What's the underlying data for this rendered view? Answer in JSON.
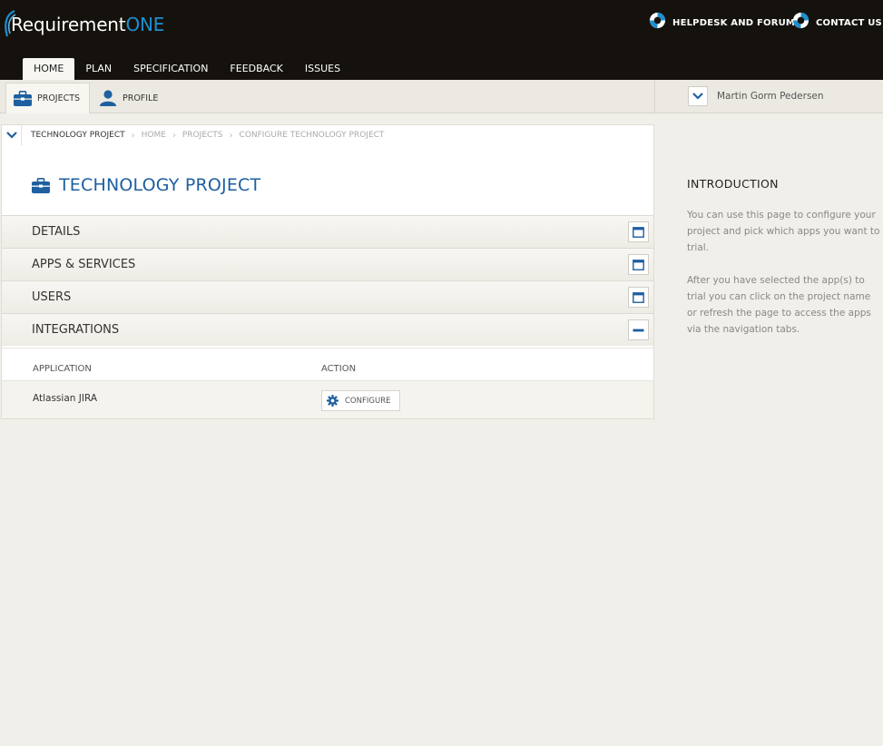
{
  "header": {
    "logo_main": "Requirement",
    "logo_accent": "ONE",
    "links": [
      {
        "label": "HELPDESK AND FORUM",
        "icon": "lifebuoy-icon"
      },
      {
        "label": "CONTACT US",
        "icon": "lifebuoy-icon"
      }
    ]
  },
  "main_nav": {
    "tabs": [
      {
        "label": "HOME",
        "active": true
      },
      {
        "label": "PLAN"
      },
      {
        "label": "SPECIFICATION"
      },
      {
        "label": "FEEDBACK"
      },
      {
        "label": "ISSUES"
      }
    ]
  },
  "sub_nav": {
    "tabs": [
      {
        "label": "PROJECTS",
        "icon": "briefcase-icon",
        "active": true
      },
      {
        "label": "PROFILE",
        "icon": "user-icon"
      }
    ]
  },
  "user": {
    "name": "Martin Gorm Pedersen"
  },
  "breadcrumb": [
    "TECHNOLOGY PROJECT",
    "HOME",
    "PROJECTS",
    "CONFIGURE TECHNOLOGY PROJECT"
  ],
  "project": {
    "title": "TECHNOLOGY PROJECT"
  },
  "sections": [
    {
      "label": "DETAILS",
      "state": "collapsed"
    },
    {
      "label": "APPS & SERVICES",
      "state": "collapsed"
    },
    {
      "label": "USERS",
      "state": "collapsed"
    },
    {
      "label": "INTEGRATIONS",
      "state": "expanded"
    }
  ],
  "integrations": {
    "columns": [
      "APPLICATION",
      "ACTION"
    ],
    "rows": [
      {
        "application": "Atlassian JIRA",
        "action": "CONFIGURE"
      }
    ]
  },
  "sidebar": {
    "title": "INTRODUCTION",
    "paragraph1_lines": [
      "You can use this page to configure your",
      "project and pick which apps you want to",
      "trial."
    ],
    "paragraph2_lines": [
      "After you have selected the app(s) to",
      "trial you can click on the project name",
      "or refresh the page to access the apps",
      "via the navigation tabs."
    ]
  },
  "colors": {
    "header_bg": "#15120d",
    "accent_blue": "#1e5fa0",
    "logo_blue": "#1d8fd0",
    "page_bg": "#f0efe9"
  }
}
